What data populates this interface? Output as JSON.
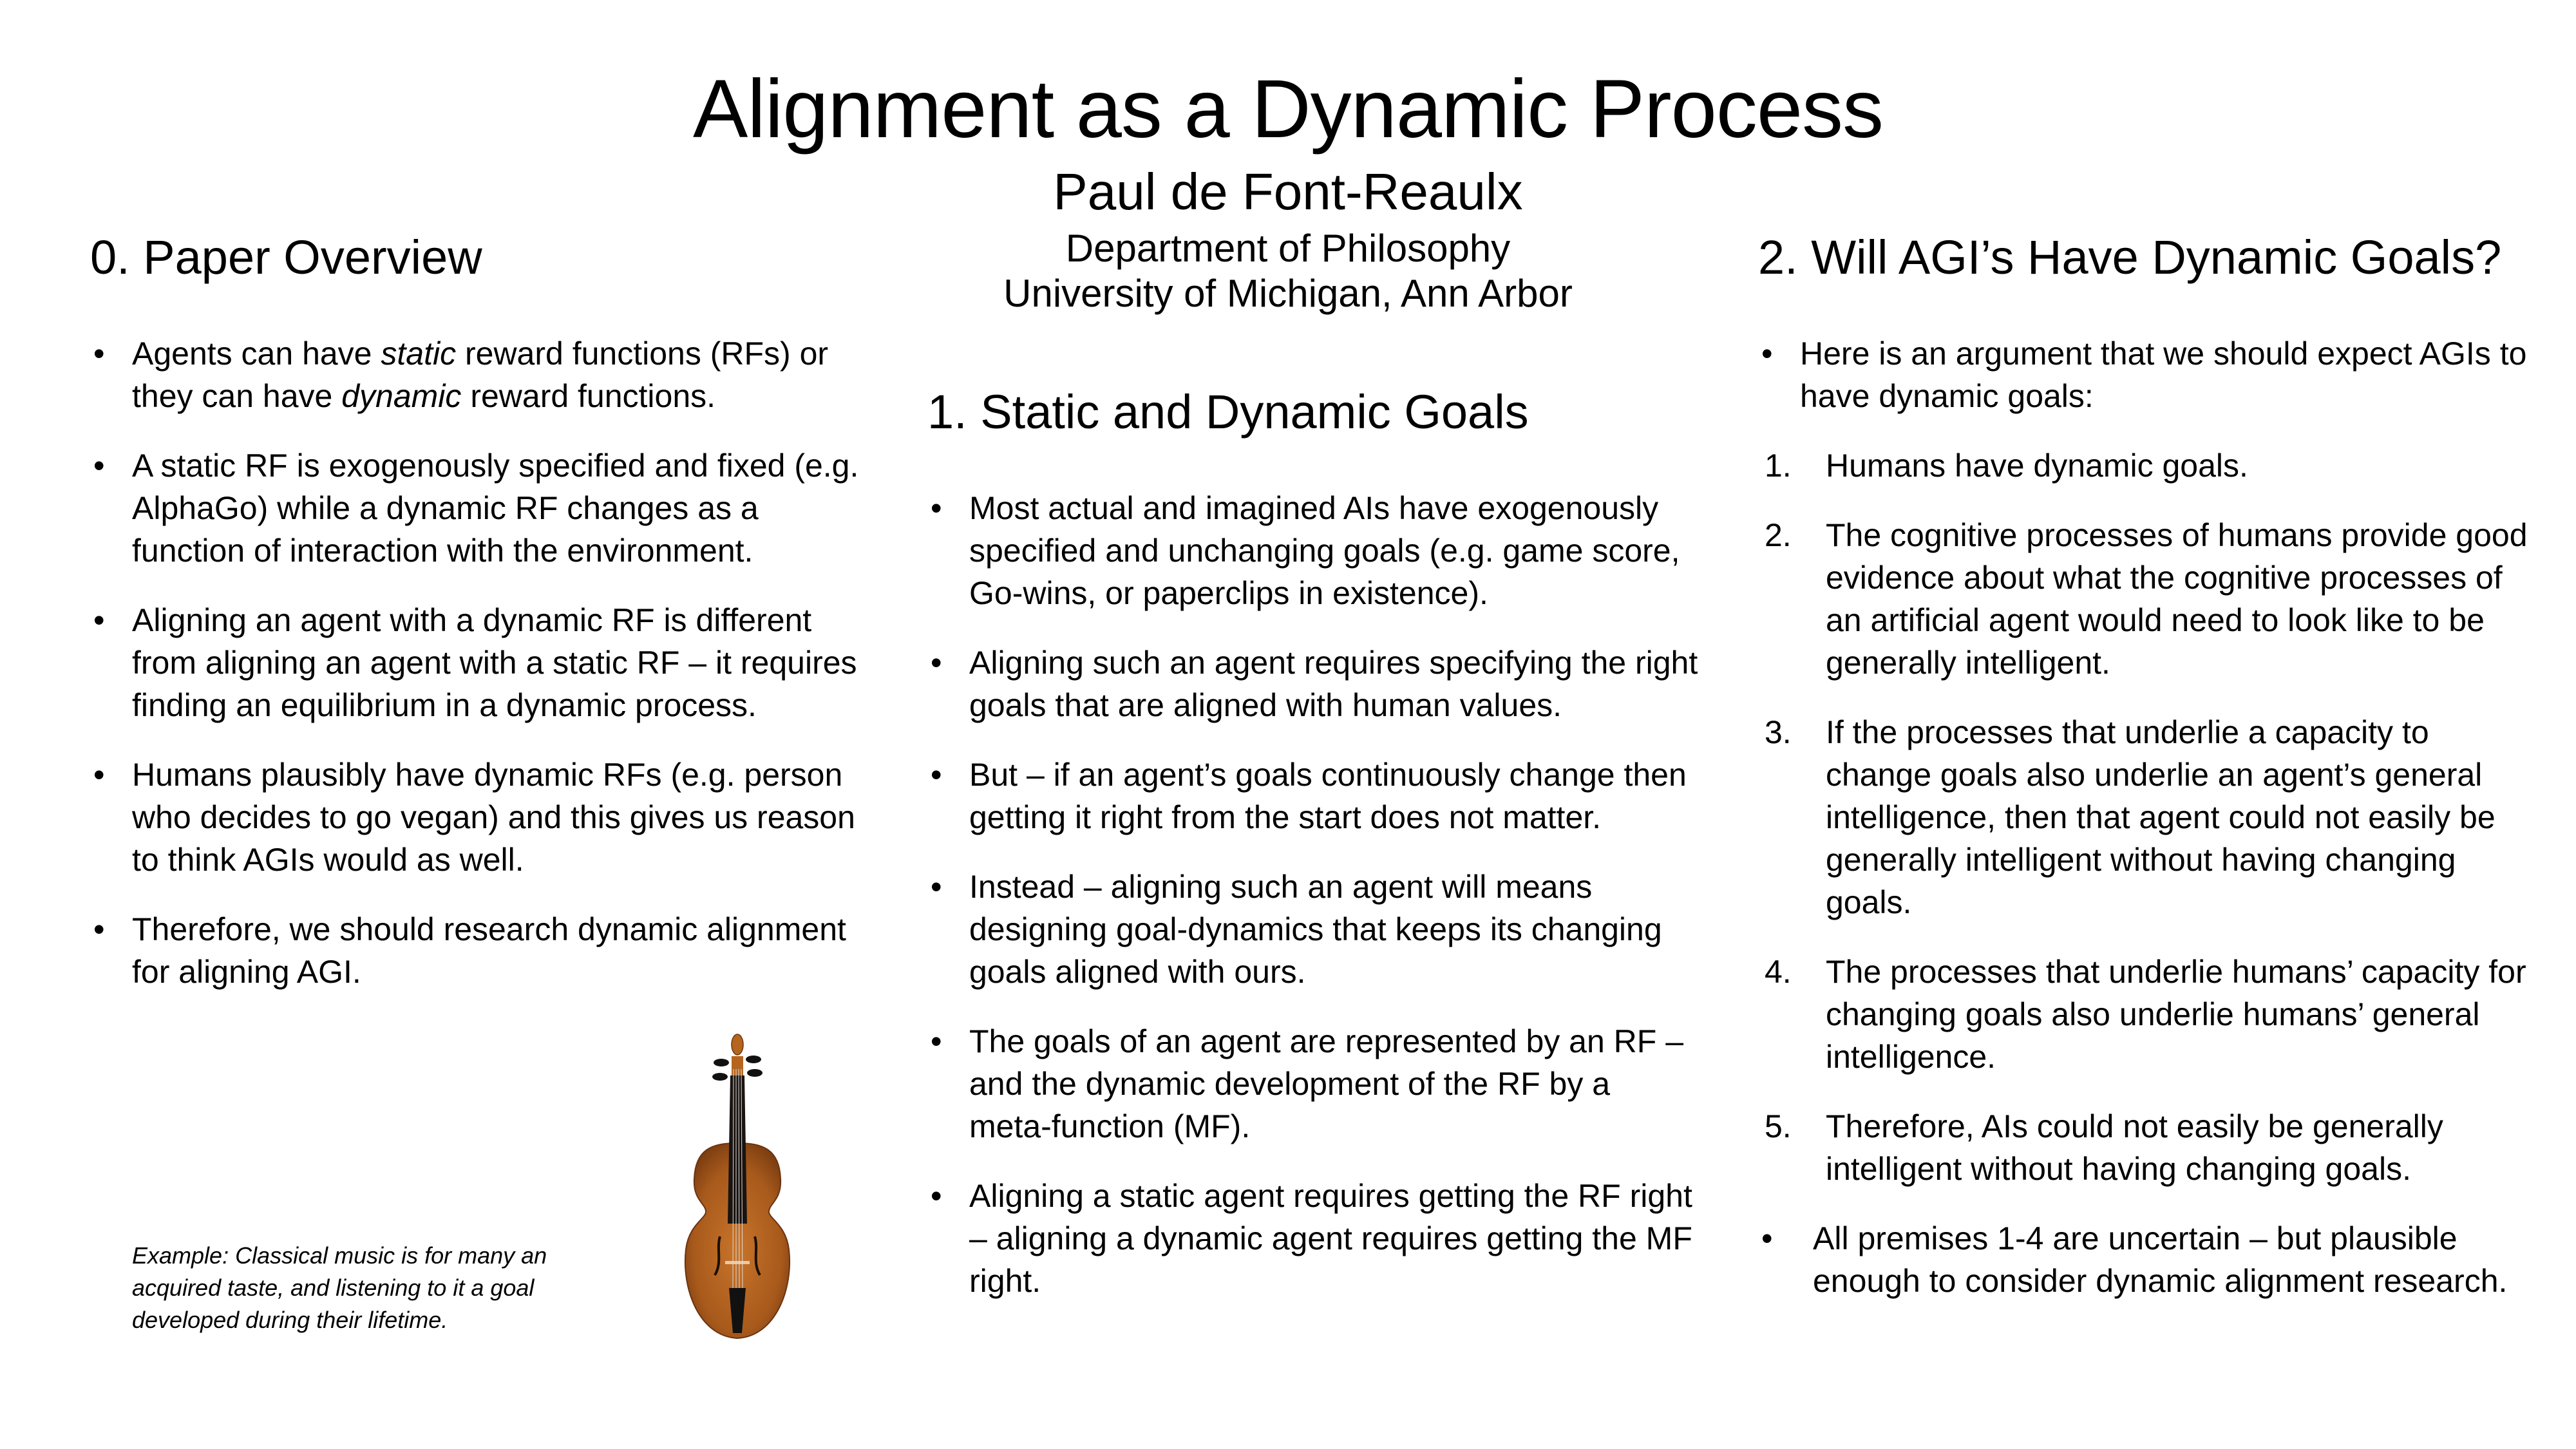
{
  "header": {
    "title": "Alignment as a Dynamic Process",
    "author": "Paul de Font-Reaulx",
    "department": "Department of Philosophy",
    "university": "University of Michigan, Ann Arbor"
  },
  "sections": [
    {
      "heading": "0. Paper Overview",
      "bullets": [
        {
          "parts": [
            {
              "text": "Agents can have ",
              "italic": false
            },
            {
              "text": "static",
              "italic": true
            },
            {
              "text": " reward functions (RFs) or they can have ",
              "italic": false
            },
            {
              "text": "dynamic",
              "italic": true
            },
            {
              "text": " reward functions.",
              "italic": false
            }
          ]
        },
        {
          "parts": [
            {
              "text": "A static RF is exogenously specified and fixed (e.g. AlphaGo) while a dynamic RF changes as a function of interaction with the environment.",
              "italic": false
            }
          ]
        },
        {
          "parts": [
            {
              "text": "Aligning an agent with a dynamic RF is different from aligning an agent with a static RF – it requires finding an equilibrium in a dynamic process.",
              "italic": false
            }
          ]
        },
        {
          "parts": [
            {
              "text": "Humans plausibly have dynamic RFs (e.g. person who decides to go vegan) and this gives us reason to think AGIs would as well.",
              "italic": false
            }
          ]
        },
        {
          "parts": [
            {
              "text": "Therefore, we should research dynamic alignment for aligning AGI.",
              "italic": false
            }
          ]
        }
      ],
      "caption": "Example: Classical music is for many an acquired taste, and listening to it a goal developed during their lifetime.",
      "image": "violin"
    },
    {
      "heading": "1. Static and Dynamic Goals",
      "bullets": [
        "Most actual and imagined AIs have exogenously specified and unchanging goals (e.g. game score, Go-wins, or paperclips in existence).",
        "Aligning such an agent requires specifying the right goals that are aligned with human values.",
        "But – if an agent’s goals continuously change then getting it right from the start does not matter.",
        "Instead – aligning such an agent will means designing goal-dynamics that keeps its changing goals aligned with ours.",
        "The goals of an agent are represented by an RF – and the dynamic development of the RF by a meta-function (MF).",
        "Aligning a static agent requires getting the RF right – aligning a dynamic agent requires getting the MF right."
      ]
    },
    {
      "heading": "2. Will AGI’s Have Dynamic Goals?",
      "intro": "Here is an argument that we should expect AGIs to have dynamic goals:",
      "premises": [
        {
          "num": "1.",
          "text": "Humans have dynamic goals."
        },
        {
          "num": "2.",
          "text": "The cognitive processes of humans provide good evidence about what the cognitive processes of an artificial agent would need to look like to be generally intelligent."
        },
        {
          "num": "3.",
          "text": "If the processes that underlie a capacity to change goals also underlie an agent’s general intelligence, then that agent could not easily be generally intelligent without having changing goals."
        },
        {
          "num": "4.",
          "text": "The processes that underlie humans’ capacity for changing goals also underlie humans’ general intelligence."
        },
        {
          "num": "5.",
          "text": "Therefore, AIs could not easily be generally intelligent without having changing goals."
        }
      ],
      "closing": "All premises 1-4 are uncertain – but plausible enough to consider dynamic alignment research."
    }
  ],
  "bullet_glyph": "•"
}
